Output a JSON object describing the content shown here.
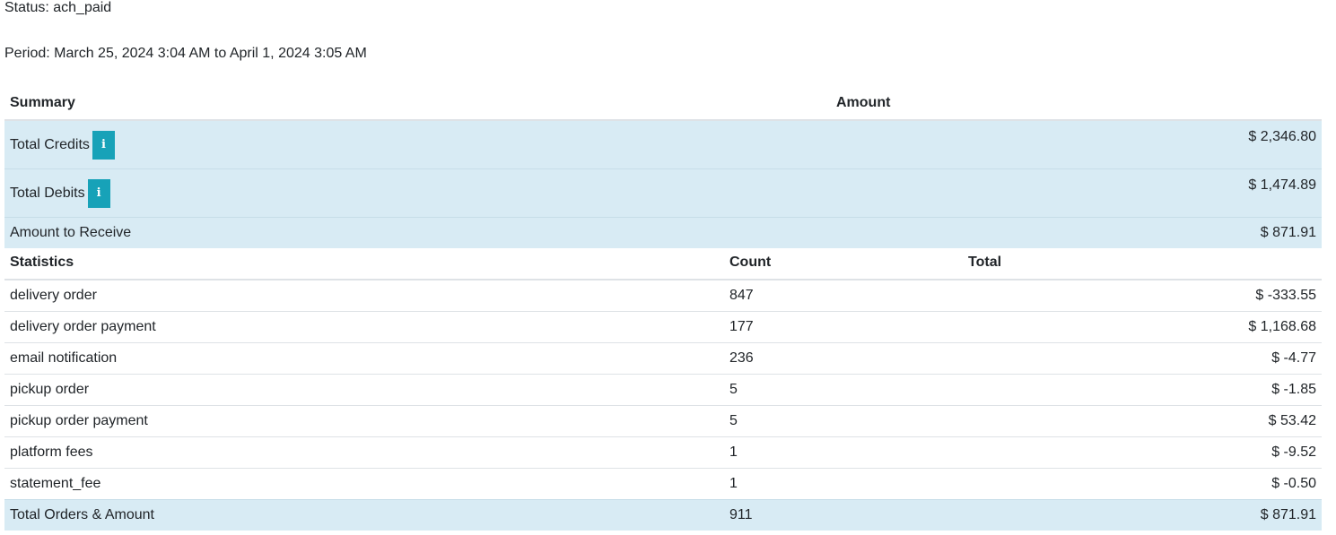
{
  "status_line": "Status: ach_paid",
  "period_line": "Period: March 25, 2024 3:04 AM to April 1, 2024 3:05 AM",
  "summary": {
    "headers": {
      "summary": "Summary",
      "amount": "Amount"
    },
    "info_icon_glyph": "i",
    "rows": [
      {
        "label": "Total Credits",
        "amount": "$ 2,346.80",
        "icon": "info-icon"
      },
      {
        "label": "Total Debits",
        "amount": "$ 1,474.89",
        "icon": "info-icon"
      },
      {
        "label": "Amount to Receive",
        "amount": "$ 871.91"
      }
    ]
  },
  "statistics": {
    "headers": {
      "statistics": "Statistics",
      "count": "Count",
      "total": "Total"
    },
    "rows": [
      {
        "label": "delivery order",
        "count": "847",
        "total": "$ -333.55"
      },
      {
        "label": "delivery order payment",
        "count": "177",
        "total": "$ 1,168.68"
      },
      {
        "label": "email notification",
        "count": "236",
        "total": "$ -4.77"
      },
      {
        "label": "pickup order",
        "count": "5",
        "total": "$ -1.85"
      },
      {
        "label": "pickup order payment",
        "count": "5",
        "total": "$ 53.42"
      },
      {
        "label": "platform fees",
        "count": "1",
        "total": "$ -9.52"
      },
      {
        "label": "statement_fee",
        "count": "1",
        "total": "$ -0.50"
      }
    ],
    "total_row": {
      "label": "Total Orders & Amount",
      "count": "911",
      "total": "$ 871.91"
    }
  },
  "colors": {
    "info_button": "#17a2b8",
    "highlight_row": "#d8ebf4"
  }
}
